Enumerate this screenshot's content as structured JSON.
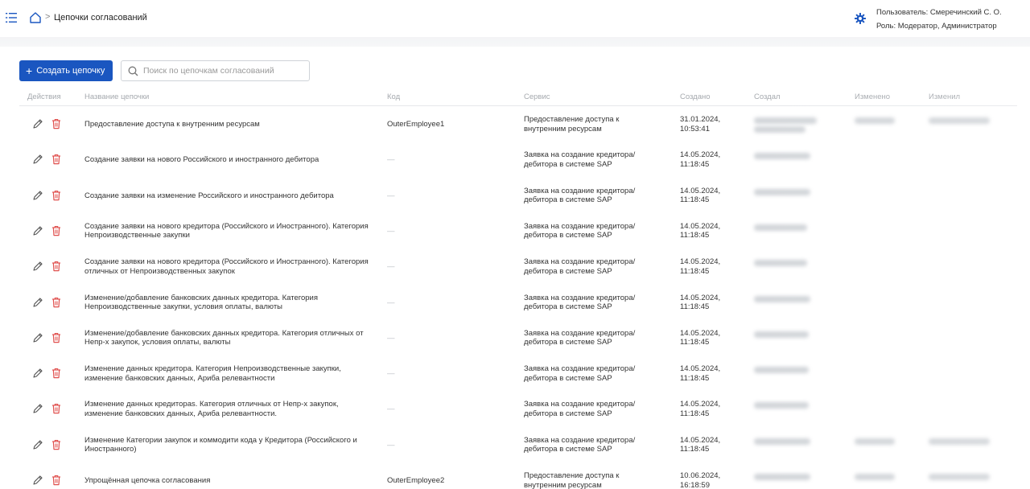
{
  "header": {
    "title": "Цепочки согласований",
    "breadcrumb_separator": ">",
    "user_label": "Пользователь: Смеречинский С. О.",
    "role_label": "Роль: Модератор, Администратор"
  },
  "toolbar": {
    "create_label": "Создать цепочку",
    "create_plus": "+",
    "search_placeholder": "Поиск по цепочкам согласований"
  },
  "table": {
    "columns": [
      "Действия",
      "Название цепочки",
      "Код",
      "Сервис",
      "Создано",
      "Создал",
      "Изменено",
      "Изменил"
    ],
    "rows": [
      {
        "name": "Предоставление доступа к внутренним ресурсам",
        "code": "OuterEmployee1",
        "service": "Предоставление доступа к внутренним ресурсам",
        "created": "31.01.2024, 10:53:41"
      },
      {
        "name": "Создание заявки на нового Российского и иностранного дебитора",
        "code": "—",
        "service": "Заявка на создание кредитора/ дебитора в системе SAP",
        "created": "14.05.2024, 11:18:45"
      },
      {
        "name": "Создание заявки на изменение Российского и иностранного дебитора",
        "code": "—",
        "service": "Заявка на создание кредитора/ дебитора в системе SAP",
        "created": "14.05.2024, 11:18:45"
      },
      {
        "name": "Создание заявки на нового кредитора (Российского и Иностранного). Категория Непроизводственные закупки",
        "code": "—",
        "service": "Заявка на создание кредитора/ дебитора в системе SAP",
        "created": "14.05.2024, 11:18:45"
      },
      {
        "name": "Создание заявки на нового кредитора (Российского и Иностранного). Категория отличных от Непроизводственных закупок",
        "code": "—",
        "service": "Заявка на создание кредитора/ дебитора в системе SAP",
        "created": "14.05.2024, 11:18:45"
      },
      {
        "name": "Изменение/добавление банковских данных кредитора. Категория Непроизводственные закупки, условия оплаты, валюты",
        "code": "—",
        "service": "Заявка на создание кредитора/ дебитора в системе SAP",
        "created": "14.05.2024, 11:18:45"
      },
      {
        "name": "Изменение/добавление банковских данных кредитора. Категория отличных от Непр-х закупок, условия оплаты, валюты",
        "code": "—",
        "service": "Заявка на создание кредитора/ дебитора в системе SAP",
        "created": "14.05.2024, 11:18:45"
      },
      {
        "name": "Изменение данных кредитора. Категория Непроизводственные закупки, изменение банковских данных, Ариба релевантности",
        "code": "—",
        "service": "Заявка на создание кредитора/ дебитора в системе SAP",
        "created": "14.05.2024, 11:18:45"
      },
      {
        "name": "Изменение данных кредитораs. Категория отличных от Непр-х закупок, изменение банковских данных, Ариба релевантности.",
        "code": "—",
        "service": "Заявка на создание кредитора/ дебитора в системе SAP",
        "created": "14.05.2024, 11:18:45"
      },
      {
        "name": "Изменение Категории закупок и коммодити кода у Кредитора (Российского и Иностранного)",
        "code": "—",
        "service": "Заявка на создание кредитора/ дебитора в системе SAP",
        "created": "14.05.2024, 11:18:45"
      },
      {
        "name": "Упрощённая цепочка согласования",
        "code": "OuterEmployee2",
        "service": "Предоставление доступа к внутренним ресурсам",
        "created": "10.06.2024, 16:18:59"
      }
    ]
  },
  "colors": {
    "primary": "#1a56c0",
    "delete_icon": "#e0504e",
    "settings_icon": "#1a56c0"
  }
}
